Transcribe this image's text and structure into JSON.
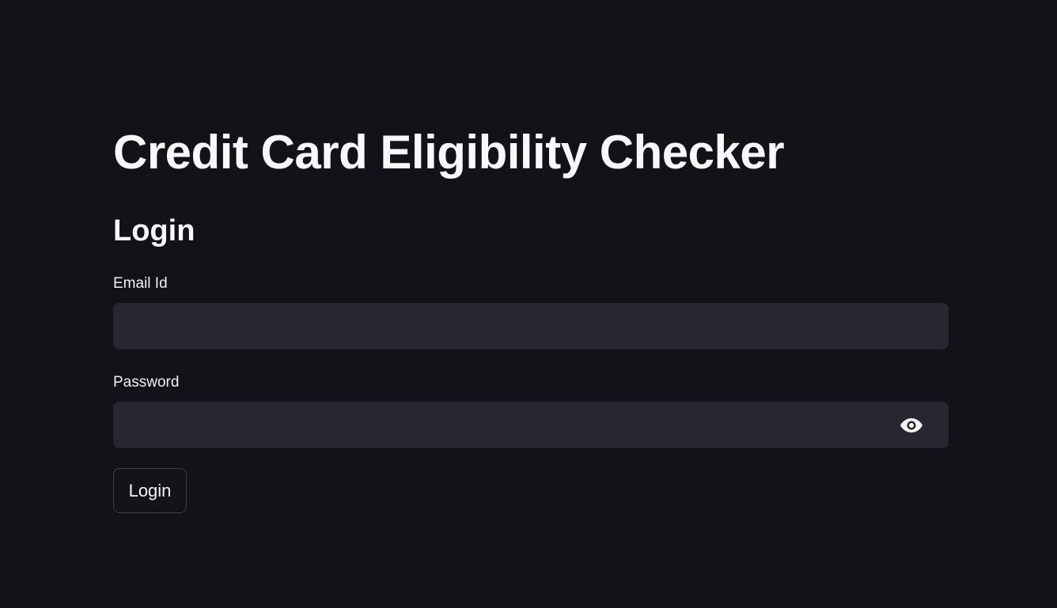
{
  "app": {
    "title": "Credit Card Eligibility Checker"
  },
  "login_form": {
    "heading": "Login",
    "email": {
      "label": "Email Id",
      "value": "",
      "placeholder": ""
    },
    "password": {
      "label": "Password",
      "value": "",
      "placeholder": "",
      "toggle_icon": "eye-icon"
    },
    "submit_label": "Login"
  },
  "colors": {
    "background": "#121318",
    "input_background": "#262730",
    "text": "#f5f6f8",
    "button_border": "#3c3e48"
  }
}
